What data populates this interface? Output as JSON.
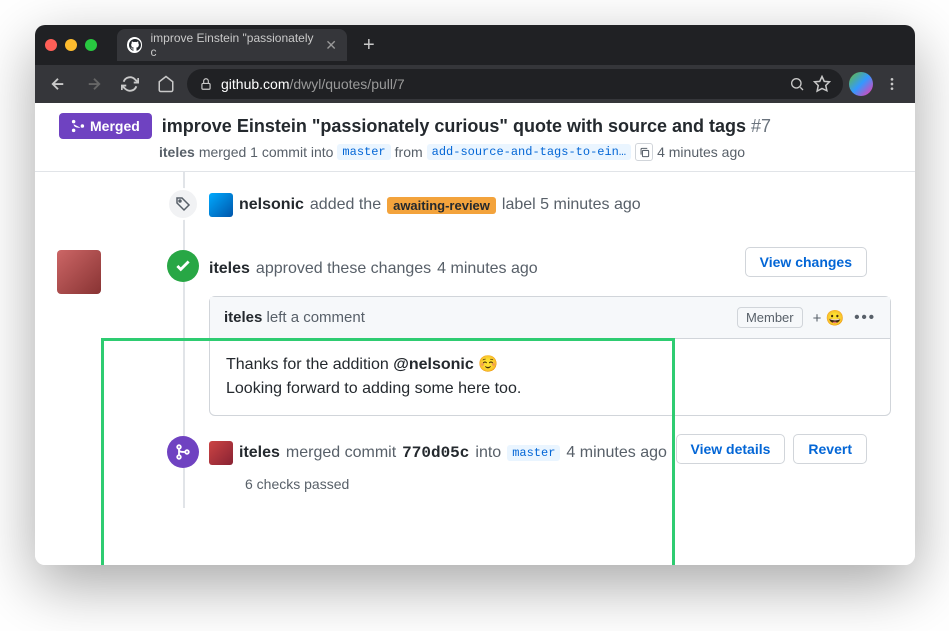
{
  "browser": {
    "tab_title": "improve Einstein \"passionately c",
    "url_host": "github.com",
    "url_path": "/dwyl/quotes/pull/7"
  },
  "pr": {
    "state": "Merged",
    "title": "improve Einstein \"passionately curious\" quote with source and tags",
    "number": "#7",
    "merger": "iteles",
    "merge_action": "merged 1 commit into",
    "base_branch": "master",
    "from_word": "from",
    "head_branch": "add-source-and-tags-to-ein…",
    "merged_time": "4 minutes ago"
  },
  "timeline": {
    "label_event": {
      "actor": "nelsonic",
      "action": "added the",
      "label": "awaiting-review",
      "suffix": "label 5 minutes ago"
    },
    "review": {
      "actor": "iteles",
      "action": "approved these changes",
      "time": "4 minutes ago",
      "view_changes": "View changes"
    },
    "comment": {
      "actor": "iteles",
      "head_action": "left a comment",
      "member_badge": "Member",
      "body1": "Thanks for the addition ",
      "mention": "@nelsonic",
      "emoji": "☺️",
      "body2": "Looking forward to adding some here too."
    },
    "merge": {
      "actor": "iteles",
      "action": "merged commit",
      "sha": "770d05c",
      "into": "into",
      "branch": "master",
      "time": "4 minutes ago",
      "view_details": "View details",
      "revert": "Revert",
      "checks": "6 checks passed"
    }
  }
}
